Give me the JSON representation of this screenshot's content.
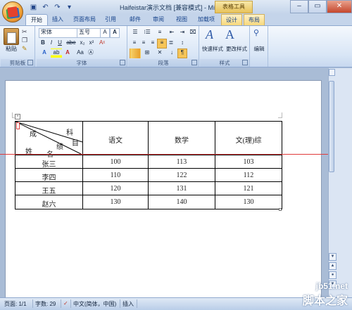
{
  "titlebar": {
    "title": "Haifeistar演示文档 [兼容模式] - Microsoft Word",
    "context_group": "表格工具"
  },
  "tabs": [
    "开始",
    "插入",
    "页面布局",
    "引用",
    "邮件",
    "审阅",
    "视图",
    "加载项",
    "设计",
    "布局"
  ],
  "ribbon": {
    "clipboard": {
      "paste": "粘贴",
      "label": "剪贴板"
    },
    "font": {
      "name": "宋体",
      "size": "五号",
      "label": "字体"
    },
    "paragraph": {
      "label": "段落"
    },
    "styles": {
      "quick": "快速样式",
      "change": "更改样式",
      "label": "样式"
    },
    "editing": {
      "label": "编辑"
    }
  },
  "table": {
    "header_diag": {
      "top1": "成",
      "top2": "科",
      "mid1": "绩",
      "mid2": "目",
      "bottom1": "姓",
      "bottom2": "名"
    },
    "columns": [
      "语文",
      "数学",
      "文(理)综"
    ],
    "rows": [
      {
        "name": "张三",
        "values": [
          "100",
          "113",
          "103"
        ]
      },
      {
        "name": "李四",
        "values": [
          "110",
          "122",
          "112"
        ]
      },
      {
        "name": "王五",
        "values": [
          "120",
          "131",
          "121"
        ]
      },
      {
        "name": "赵六",
        "values": [
          "130",
          "140",
          "130"
        ]
      }
    ]
  },
  "status": {
    "page": "页面: 1/1",
    "words": "字数: 29",
    "lang": "中文(简体，中国)",
    "mode": "插入"
  },
  "watermark": {
    "site": "jb51.net",
    "name": "脚本之家"
  }
}
